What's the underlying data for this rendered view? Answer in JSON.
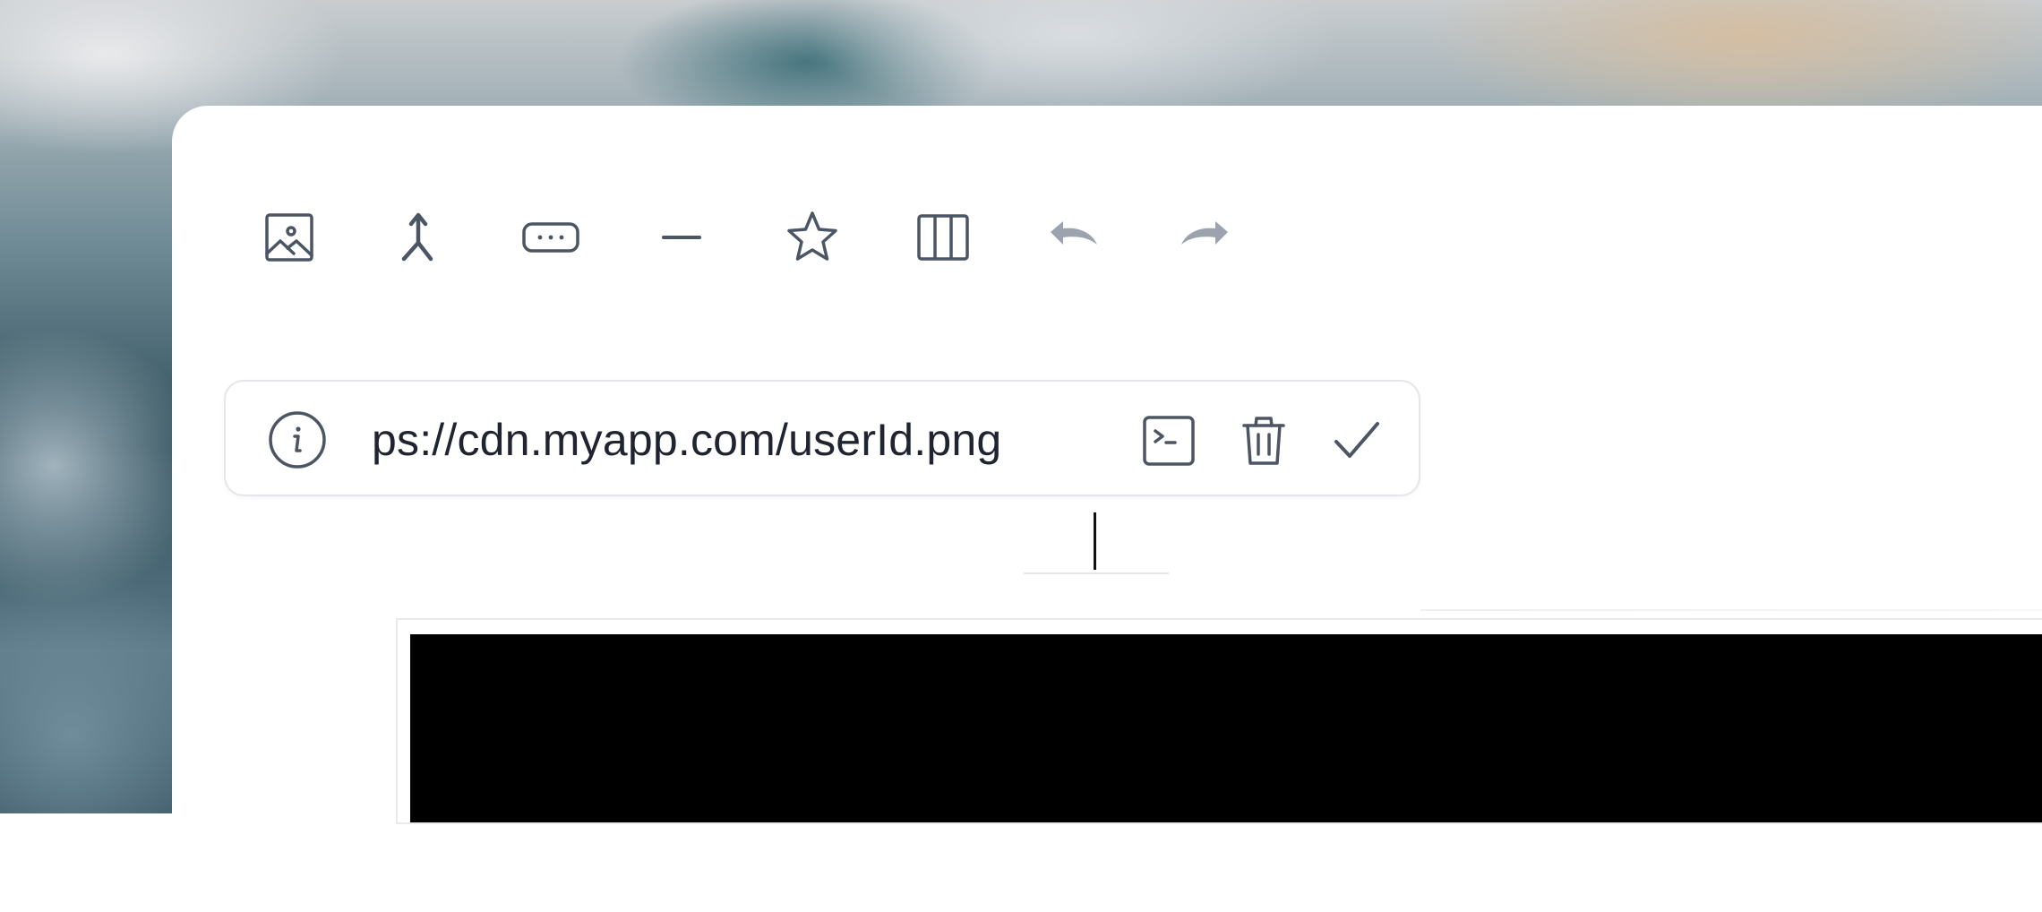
{
  "toolbar": {
    "items": [
      {
        "name": "image-icon",
        "label": "Image",
        "enabled": true
      },
      {
        "name": "merge-icon",
        "label": "Merge",
        "enabled": true
      },
      {
        "name": "more-icon",
        "label": "More",
        "enabled": true
      },
      {
        "name": "horizontal-rule-icon",
        "label": "Divider",
        "enabled": true
      },
      {
        "name": "star-icon",
        "label": "Favorite",
        "enabled": true
      },
      {
        "name": "columns-icon",
        "label": "Columns",
        "enabled": true
      },
      {
        "name": "undo-icon",
        "label": "Undo",
        "enabled": false
      },
      {
        "name": "redo-icon",
        "label": "Redo",
        "enabled": false
      }
    ]
  },
  "url_editor": {
    "value": "ps://cdn.myapp.com/userId.png",
    "info_icon": "info-icon",
    "actions": [
      {
        "name": "terminal-icon"
      },
      {
        "name": "trash-icon"
      },
      {
        "name": "check-icon"
      }
    ]
  },
  "colors": {
    "icon": "#4b5563",
    "icon_disabled": "#9ca3af",
    "text": "#1f2430",
    "border": "#e4e6ea",
    "preview_bg": "#000000"
  }
}
